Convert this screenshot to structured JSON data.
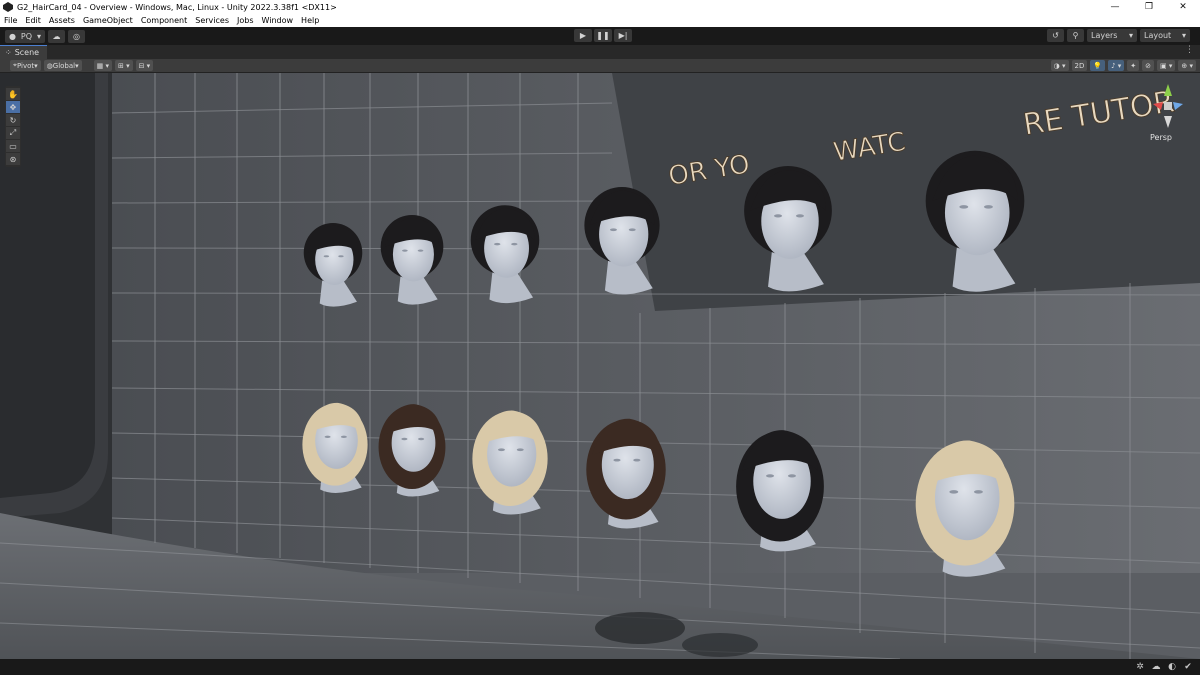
{
  "window": {
    "title": "G2_HairCard_04 - Overview - Windows, Mac, Linux - Unity 2022.3.38f1 <DX11>",
    "controls": [
      "—",
      "❐",
      "✕"
    ]
  },
  "menu": [
    "File",
    "Edit",
    "Assets",
    "GameObject",
    "Component",
    "Services",
    "Jobs",
    "Window",
    "Help"
  ],
  "toolbar": {
    "account_label": "PQ",
    "layers_label": "Layers",
    "layout_label": "Layout"
  },
  "scene_tab": {
    "label": "Scene"
  },
  "scene_toolbar": {
    "pivot_label": "Pivot",
    "global_label": "Global",
    "mode_2d_label": "2D"
  },
  "viewport": {
    "sign_text": "OR YOU WATCH THE TUTOR",
    "sign_visible_left": "OR YO",
    "sign_visible_mid": "WATC",
    "sign_visible_right": "RE TUTOR",
    "persp_label": "Persp"
  },
  "heads": [
    {
      "row": "top",
      "hair": "dark"
    },
    {
      "row": "top",
      "hair": "dark"
    },
    {
      "row": "top",
      "hair": "dark"
    },
    {
      "row": "top",
      "hair": "dark"
    },
    {
      "row": "top",
      "hair": "dark"
    },
    {
      "row": "top",
      "hair": "dark"
    },
    {
      "row": "bottom",
      "hair": "blonde"
    },
    {
      "row": "bottom",
      "hair": "brown"
    },
    {
      "row": "bottom",
      "hair": "blonde"
    },
    {
      "row": "bottom",
      "hair": "brown"
    },
    {
      "row": "bottom",
      "hair": "dark"
    },
    {
      "row": "bottom",
      "hair": "blonde"
    }
  ],
  "colors": {
    "hair_dark": "#1c1b1d",
    "hair_brown": "#3b2a22",
    "hair_blonde": "#d9c9a8",
    "skin": "#c7ccd6",
    "selection_blue": "#4a6fa5"
  }
}
